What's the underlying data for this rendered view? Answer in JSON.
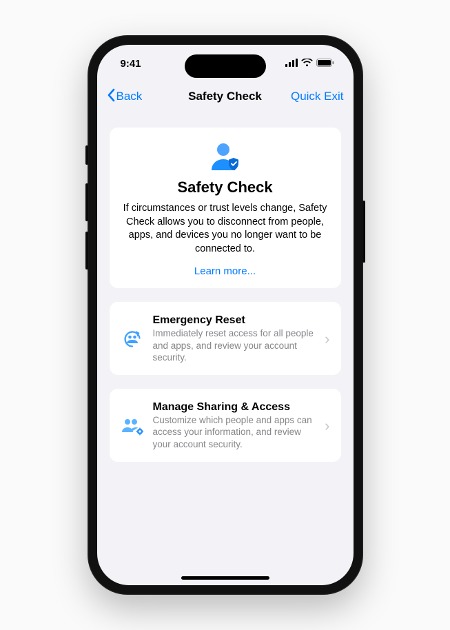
{
  "status": {
    "time": "9:41"
  },
  "nav": {
    "back_label": "Back",
    "title": "Safety Check",
    "quick_exit_label": "Quick Exit"
  },
  "intro": {
    "title": "Safety Check",
    "description": "If circumstances or trust levels change, Safety Check allows you to disconnect from people, apps, and devices you no longer want to be connected to.",
    "learn_more": "Learn more..."
  },
  "rows": [
    {
      "title": "Emergency Reset",
      "description": "Immediately reset access for all people and apps, and review your account security."
    },
    {
      "title": "Manage Sharing & Access",
      "description": "Customize which people and apps can access your information, and review your account security."
    }
  ],
  "colors": {
    "accent": "#007aff"
  }
}
